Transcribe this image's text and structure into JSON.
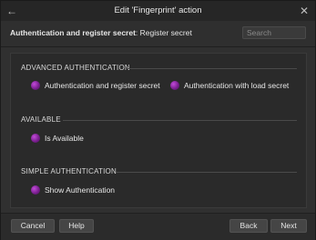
{
  "window": {
    "title": "Edit 'Fingerprint' action"
  },
  "header": {
    "breadcrumb_bold": "Authentication and register secret",
    "breadcrumb_rest": ": Register secret",
    "search_placeholder": "Search"
  },
  "sections": [
    {
      "title": "ADVANCED AUTHENTICATION",
      "items": [
        {
          "label": "Authentication and register secret",
          "icon": "purple-circle-icon"
        },
        {
          "label": "Authentication with load secret",
          "icon": "purple-circle-icon"
        }
      ]
    },
    {
      "title": "AVAILABLE",
      "items": [
        {
          "label": "Is Available",
          "icon": "purple-circle-icon"
        }
      ]
    },
    {
      "title": "SIMPLE AUTHENTICATION",
      "items": [
        {
          "label": "Show Authentication",
          "icon": "purple-circle-icon"
        }
      ]
    }
  ],
  "footer": {
    "cancel_label": "Cancel",
    "help_label": "Help",
    "back_label": "Back",
    "next_label": "Next"
  },
  "colors": {
    "icon_accent": "#a83cc0",
    "background": "#303030"
  }
}
